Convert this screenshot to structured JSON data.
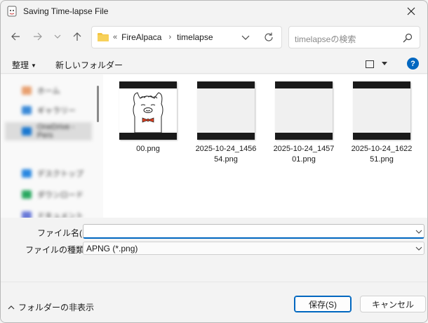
{
  "window": {
    "title": "Saving Time-lapse File"
  },
  "navbar": {
    "breadcrumb": [
      "FireAlpaca",
      "timelapse"
    ],
    "overflow": "«",
    "search_placeholder": "timelapseの検索"
  },
  "commandbar": {
    "organize_label": "整理",
    "new_folder_label": "新しいフォルダー"
  },
  "nav_pane": {
    "items": [
      {
        "label": "ホーム",
        "color": "#e8a070"
      },
      {
        "label": "ギャラリー",
        "color": "#3a8ad8"
      },
      {
        "label": "OneDrive - Pers",
        "color": "#1a78d0"
      },
      {
        "label": "デスクトップ",
        "color": "#2a88e0"
      },
      {
        "label": "ダウンロード",
        "color": "#2aa860"
      },
      {
        "label": "ドキュメント",
        "color": "#6a7ad8"
      }
    ]
  },
  "files": [
    {
      "name": "00.png",
      "thumb": "alpaca"
    },
    {
      "name": "2025-10-24_145654.png",
      "thumb": "blank"
    },
    {
      "name": "2025-10-24_145701.png",
      "thumb": "blank"
    },
    {
      "name": "2025-10-24_162251.png",
      "thumb": "blank"
    }
  ],
  "form": {
    "filename_label": "ファイル名(N):",
    "filename_value": "",
    "filetype_label": "ファイルの種類(T):",
    "filetype_value": "APNG (*.png)"
  },
  "footer": {
    "hide_folders_label": "フォルダーの非表示",
    "save_label": "保存(S)",
    "cancel_label": "キャンセル"
  },
  "colors": {
    "accent": "#0067c0",
    "folder": "#f4c542"
  }
}
